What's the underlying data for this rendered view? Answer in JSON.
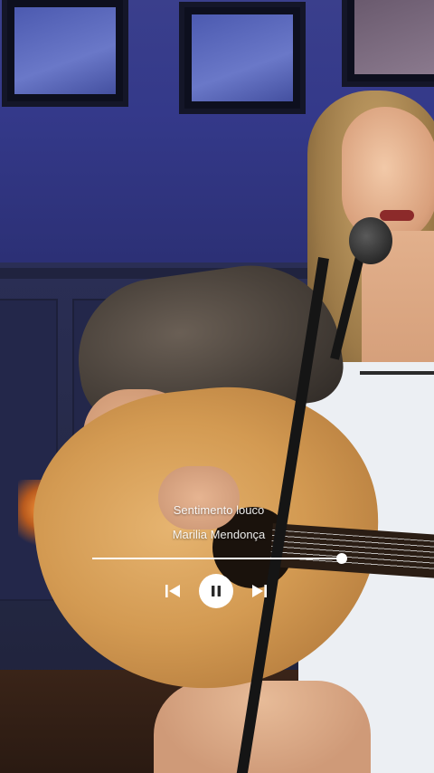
{
  "player": {
    "track_title": "Sentimento louco",
    "artist": "Marilia Mendonça",
    "progress_fraction": 1.0,
    "is_playing": true,
    "icons": {
      "previous": "skip-previous-icon",
      "pause": "pause-icon",
      "next": "skip-next-icon"
    }
  },
  "colors": {
    "overlay_text": "#ffffff",
    "play_button_bg": "#ffffff",
    "play_button_icon": "#2a2a2a"
  }
}
